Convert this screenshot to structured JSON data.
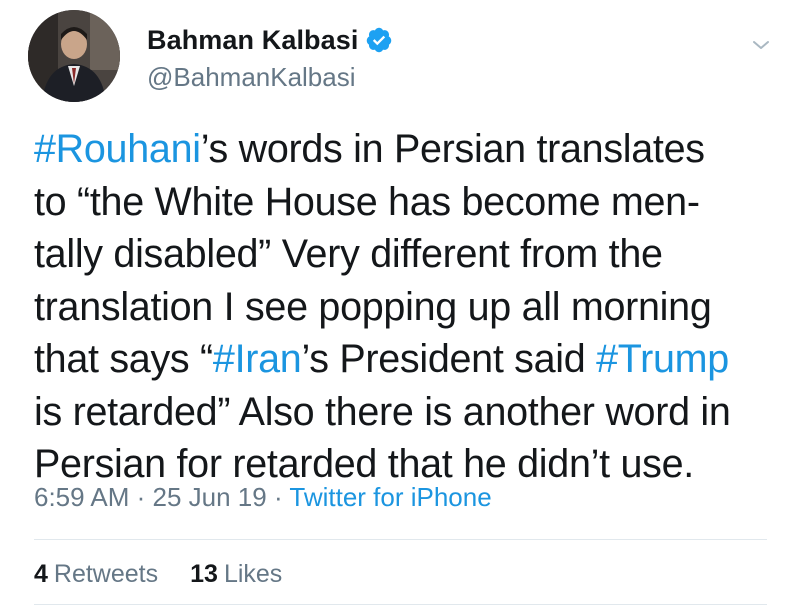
{
  "author": {
    "display_name": "Bahman Kalbasi",
    "handle": "@BahmanKalbasi",
    "verified": true
  },
  "tweet": {
    "lines": [
      [
        {
          "text": "#Rouhani",
          "tag": true
        },
        {
          "text": "’s words in Persian translates",
          "tag": false
        }
      ],
      [
        {
          "text": "to “the White House has become men-",
          "tag": false
        }
      ],
      [
        {
          "text": "tally disabled” Very different from the",
          "tag": false
        }
      ],
      [
        {
          "text": "translation I see popping up all morning",
          "tag": false
        }
      ],
      [
        {
          "text": "that says “",
          "tag": false
        },
        {
          "text": "#Iran",
          "tag": true
        },
        {
          "text": "’s President said ",
          "tag": false
        },
        {
          "text": "#Trump",
          "tag": true
        }
      ],
      [
        {
          "text": "is retarded” Also there is another word in",
          "tag": false
        }
      ],
      [
        {
          "text": "Persian for retarded that he didn’t use.",
          "tag": false
        }
      ]
    ]
  },
  "meta": {
    "time": "6:59 AM",
    "separator": " · ",
    "date": "25 Jun 19",
    "source": "Twitter for iPhone"
  },
  "stats": {
    "retweets_count": "4",
    "retweets_label": "Retweets",
    "likes_count": "13",
    "likes_label": "Likes"
  },
  "icons": {
    "verified": "verified-badge-icon",
    "menu": "chevron-down-icon"
  },
  "colors": {
    "link": "#1b95e0",
    "text": "#14171a",
    "secondary": "#657786",
    "divider": "#e1e8ed"
  }
}
